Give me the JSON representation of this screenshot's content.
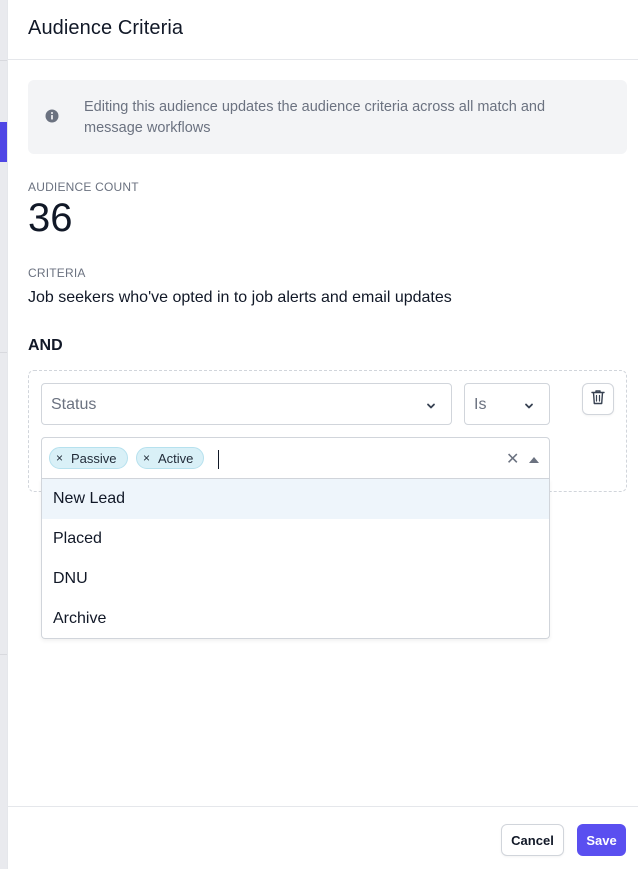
{
  "header": {
    "title": "Audience Criteria"
  },
  "info": {
    "icon": "info-icon",
    "message": "Editing this audience updates the audience criteria across all match and message workflows"
  },
  "audience": {
    "count_label": "AUDIENCE COUNT",
    "count": "36",
    "criteria_label": "CRITERIA",
    "criteria_text": "Job seekers who've opted in to job alerts and email updates"
  },
  "rule": {
    "conjunction": "AND",
    "field": "Status",
    "operator": "Is",
    "selected_values": [
      "Passive",
      "Active"
    ],
    "chip_remove_glyph": "×",
    "clear_glyph": "✕",
    "options": [
      "New Lead",
      "Placed",
      "DNU",
      "Archive"
    ],
    "highlighted_option": "New Lead",
    "delete_icon": "trash-icon"
  },
  "footer": {
    "cancel_label": "Cancel",
    "save_label": "Save"
  },
  "colors": {
    "primary": "#5a4ff0",
    "chip_bg": "#d9f0f7",
    "info_bg": "#f3f4f6"
  }
}
